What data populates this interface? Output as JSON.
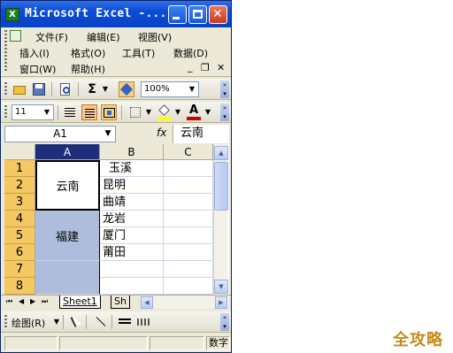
{
  "window": {
    "title": "Microsoft Excel -...",
    "app_icon_letter": "X",
    "min_label": "—",
    "max_label": "□",
    "close_label": "✕"
  },
  "menu": {
    "row1": [
      "文件(F)",
      "编辑(E)",
      "视图(V)"
    ],
    "row2": [
      "插入(I)",
      "格式(O)",
      "工具(T)",
      "数据(D)"
    ],
    "row3": [
      "窗口(W)",
      "帮助(H)"
    ],
    "mdi": [
      "_",
      "❐",
      "✕"
    ]
  },
  "toolbar_standard": {
    "zoom": "100%",
    "sigma": "Σ"
  },
  "toolbar_format": {
    "font_size": "11",
    "font_color_letter": "A",
    "accent_color": "#cc0000",
    "fill_color": "#ffff00"
  },
  "formula_bar": {
    "name_box": "A1",
    "fx": "fx",
    "value": "云南"
  },
  "sheet": {
    "columns": [
      "A",
      "B",
      "C"
    ],
    "rows": [
      "1",
      "2",
      "3",
      "4",
      "5",
      "6",
      "7",
      "8"
    ],
    "merged_a": [
      {
        "text": "云南"
      },
      {
        "text": "福建"
      }
    ],
    "col_b": [
      "玉溪",
      "昆明",
      "曲靖",
      "龙岩",
      "厦门",
      "莆田",
      "",
      ""
    ]
  },
  "tabs": {
    "nav": [
      "⏮",
      "◀",
      "▶",
      "⏭"
    ],
    "sheets": [
      "Sheet1",
      "Sh"
    ]
  },
  "drawbar": {
    "draw_label": "绘图(R)"
  },
  "status": {
    "mode": "数字"
  },
  "watermark": "全攻略"
}
